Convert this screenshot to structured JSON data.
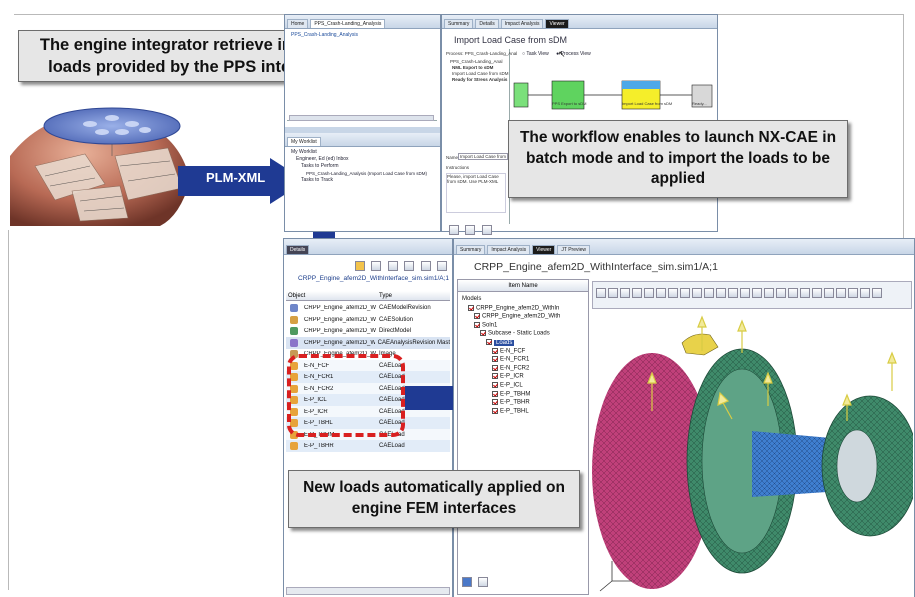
{
  "callouts": {
    "top_left": "The engine integrator retrieve interface loads provided by the PPS integrator",
    "workflow": "The workflow enables to launch NX-CAE in batch mode and to import the loads to be applied",
    "bottom": "New loads automatically applied on engine FEM interfaces",
    "plm_xml": "PLM-XML"
  },
  "top_left_window": {
    "tabs": [
      "Home",
      "PPS_Crash-Landing_Analysis"
    ],
    "tab2_content": "PPS_Crash-Landing_Analysis",
    "worklist_tab": "My Worklist",
    "tree": [
      "My Worklist",
      "Engineer, Ed (ed) Inbox",
      "Tasks to Perform",
      "PPS_Crash-Landing_Analysis (Import Load Case from sDM)",
      "Tasks to Track"
    ]
  },
  "workflow_window": {
    "tabs": [
      "Summary",
      "Details",
      "Impact Analysis",
      "Viewer"
    ],
    "title": "Import Load Case from sDM",
    "radio_task": "Task View",
    "radio_process": "Process View",
    "process_label": "Process: PPS_Crash-Landing_Anal",
    "process_items": [
      "PPS_Crash-Landing_Anal",
      "NML Export to sDM",
      "Import Load Case from sDM",
      "Ready for Stress Analysis"
    ],
    "name_label": "Name",
    "name_value": "Import Load Case from sDM",
    "instructions_label": "Instructions",
    "instructions_text": "Please, import Load Case from sDM. Use PLM-XML",
    "node_labels": [
      "",
      "PPS Export to sDM",
      "Import Load Case from sDM",
      "Ready..."
    ]
  },
  "details_panel": {
    "tab": "Details",
    "path": "CRPP_Engine_afem2D_WithInterface_sim.sim1/A;1",
    "col_object": "Object",
    "col_type": "Type",
    "rows": [
      {
        "object": "CRPP_Engine_afem2D_Wi",
        "type": "CAEModelRevision",
        "color": "#6f86c9"
      },
      {
        "object": "CRPP_Engine_afem2D_Wi",
        "type": "CAESolution",
        "color": "#d6a044"
      },
      {
        "object": "CRPP_Engine_afem2D_Wi",
        "type": "DirectModel",
        "color": "#4f9a60"
      },
      {
        "object": "CRPP_Engine_afem2D_Wi",
        "type": "CAEAnalysisRevision Mast",
        "color": "#8a74c9"
      },
      {
        "object": "CRPP_Engine_afem2D_Wi",
        "type": "Image",
        "color": "#c79a55"
      },
      {
        "object": "E-N_FCF",
        "type": "CAELoad",
        "color": "#e7a33a"
      },
      {
        "object": "E-N_FCR1",
        "type": "CAELoad",
        "color": "#e7a33a"
      },
      {
        "object": "E-N_FCR2",
        "type": "CAELoad",
        "color": "#e7a33a"
      },
      {
        "object": "E-P_ICL",
        "type": "CAELoad",
        "color": "#e7a33a"
      },
      {
        "object": "E-P_ICR",
        "type": "CAELoad",
        "color": "#e7a33a"
      },
      {
        "object": "E-P_TBHL",
        "type": "CAELoad",
        "color": "#e7a33a"
      },
      {
        "object": "E-P_TBHM",
        "type": "CAELoad",
        "color": "#e7a33a"
      },
      {
        "object": "E-P_TBHR",
        "type": "CAELoad",
        "color": "#e7a33a"
      }
    ]
  },
  "viewer_panel": {
    "tabs": [
      "Summary",
      "Impact Analysis",
      "Viewer",
      "JT Preview"
    ],
    "title": "CRPP_Engine_afem2D_WithInterface_sim.sim1/A;1",
    "item_name_header": "Item Name",
    "tree": [
      {
        "label": "Models",
        "indent": 0,
        "icon": false
      },
      {
        "label": "CRPP_Engine_afem2D_WithIn",
        "indent": 1,
        "icon": true
      },
      {
        "label": "CRPP_Engine_afem2D_With",
        "indent": 2,
        "icon": true
      },
      {
        "label": "Soln1",
        "indent": 2,
        "icon": true
      },
      {
        "label": "Subcase - Static Loads",
        "indent": 3,
        "icon": true
      },
      {
        "label": "Loads",
        "indent": 4,
        "icon": true,
        "selected": true
      },
      {
        "label": "E-N_FCF",
        "indent": 5,
        "icon": true
      },
      {
        "label": "E-N_FCR1",
        "indent": 5,
        "icon": true
      },
      {
        "label": "E-N_FCR2",
        "indent": 5,
        "icon": true
      },
      {
        "label": "E-P_ICR",
        "indent": 5,
        "icon": true
      },
      {
        "label": "E-P_ICL",
        "indent": 5,
        "icon": true
      },
      {
        "label": "E-P_TBHM",
        "indent": 5,
        "icon": true
      },
      {
        "label": "E-P_TBHR",
        "indent": 5,
        "icon": true
      },
      {
        "label": "E-P_TBHL",
        "indent": 5,
        "icon": true
      }
    ]
  },
  "colors": {
    "arrow_blue": "#1f3a93",
    "callout_bg": "#e6e6e6",
    "dashed_red": "#d92020",
    "mesh_green": "#3f8a6a",
    "mesh_magenta": "#c0407a",
    "shaft_blue": "#3f7fd0",
    "ui_blue": "#7a8ea8"
  }
}
